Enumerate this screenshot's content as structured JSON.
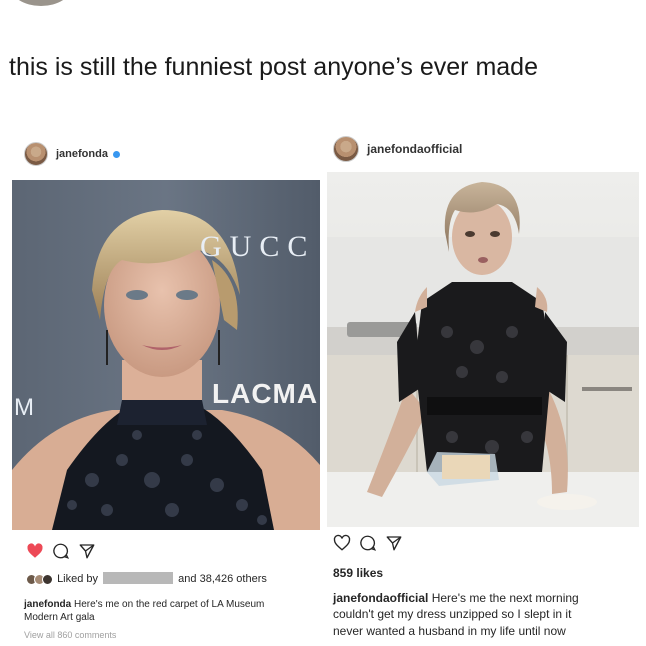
{
  "headline": "this is still the funniest post anyone’s ever made",
  "left_post": {
    "username": "janefonda",
    "photo_sign_text_1": "GUCC",
    "photo_sign_text_2": "LACMA",
    "photo_sign_text_3": "M",
    "liked_by_prefix": "Liked by",
    "liked_by_suffix": "and 38,426 others",
    "caption_username": "janefonda",
    "caption_line_1": "Here's me on the red carpet of LA Museum",
    "caption_line_2": "Modern Art gala",
    "view_comments": "View all 860 comments",
    "heart_color": "#ed4956",
    "icons": [
      "heart-filled-icon",
      "comment-icon",
      "share-icon"
    ]
  },
  "right_post": {
    "username": "janefondaofficial",
    "likes": "859 likes",
    "caption_username": "janefondaofficial",
    "caption_line_1": "Here's me the next morning",
    "caption_line_2": "couldn't get my dress unzipped so I slept in it",
    "caption_line_3": "never wanted a husband in my life until now",
    "icons": [
      "heart-outline-icon",
      "comment-icon",
      "share-icon"
    ]
  }
}
